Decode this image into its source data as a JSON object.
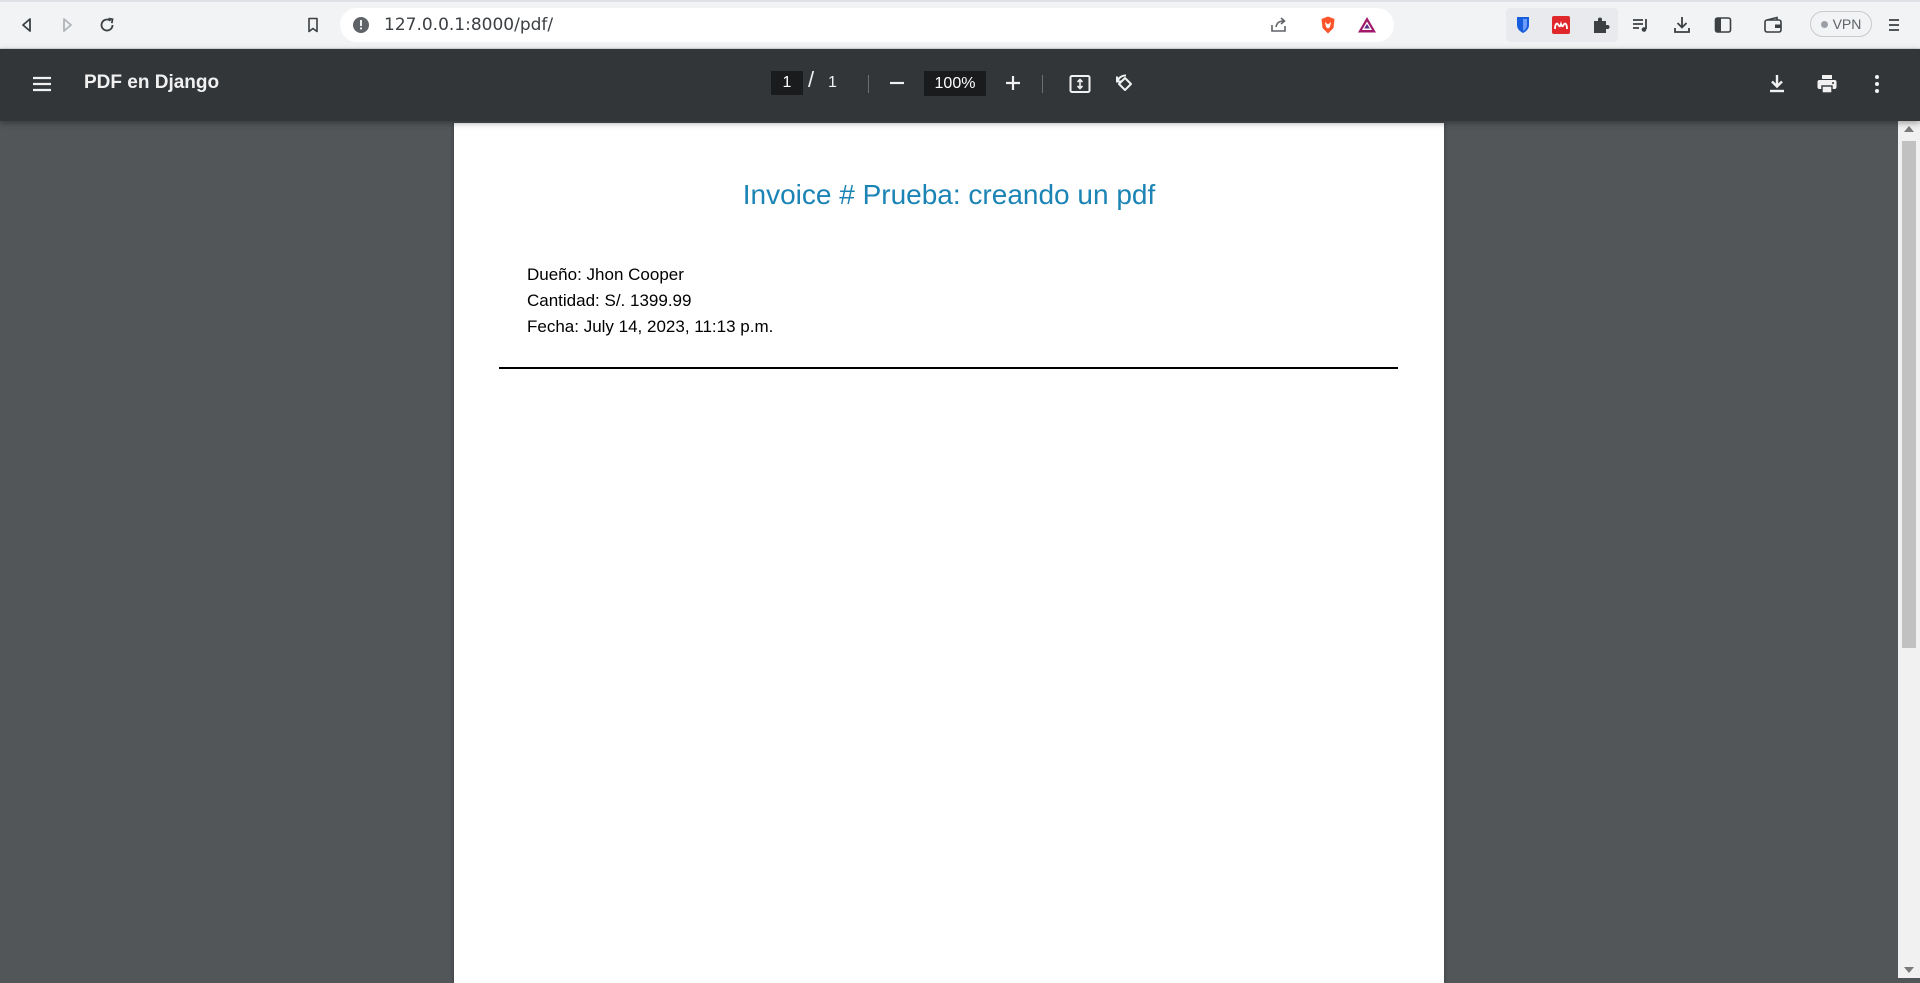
{
  "browser": {
    "url": "127.0.0.1:8000/pdf/",
    "vpn_label": "VPN"
  },
  "viewer": {
    "title": "PDF en Django",
    "current_page": "1",
    "page_separator": "/",
    "total_pages": "1",
    "zoom": "100%"
  },
  "document": {
    "title": "Invoice # Prueba: creando un pdf",
    "fields": [
      "Dueño: Jhon Cooper",
      "Cantidad: S/. 1399.99",
      "Fecha: July 14, 2023, 11:13 p.m."
    ]
  },
  "colors": {
    "toolbar_bg": "#323639",
    "doc_bg": "#525659",
    "title_accent": "#1b84b5"
  }
}
